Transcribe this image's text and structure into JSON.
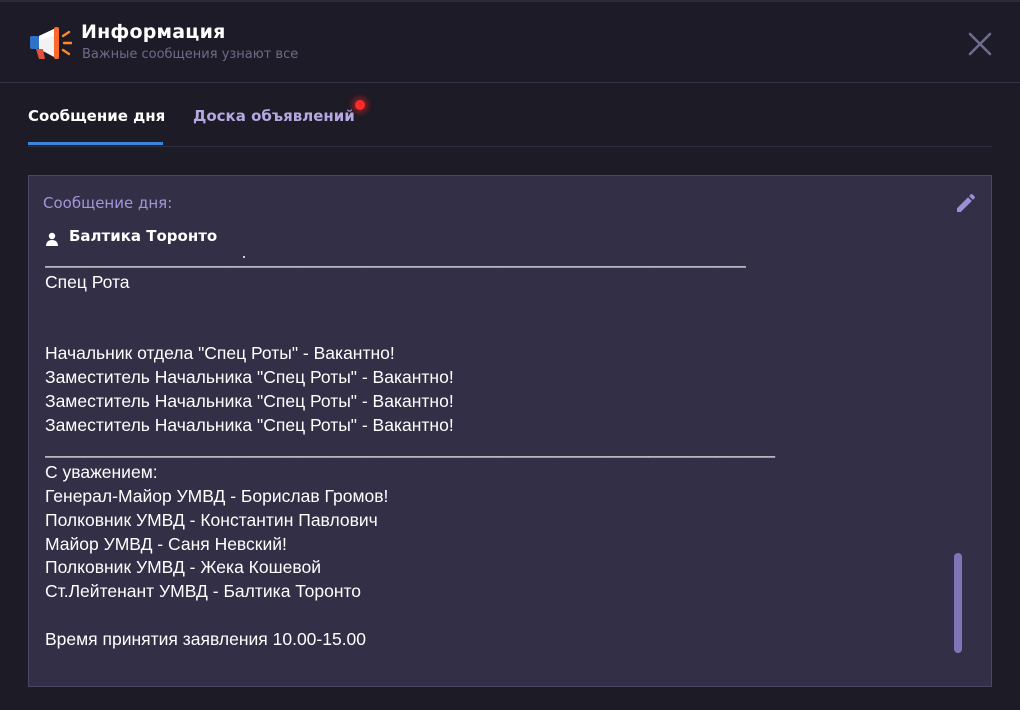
{
  "header": {
    "title": "Информация",
    "subtitle": "Важные сообщения узнают все",
    "icon": "megaphone-icon",
    "close_icon": "close-icon"
  },
  "tabs": [
    {
      "label": "Сообщение дня",
      "active": true
    },
    {
      "label": "Доска объявлений",
      "active": false,
      "has_notification": true
    }
  ],
  "panel": {
    "label": "Сообщение дня:",
    "author": "Балтика Торонто",
    "message": "________________________________________________________________________\nСпец Рота\n\n\nНачальник отдела \"Спец Роты\" - Вакантно!\nЗаместитель Начальника \"Спец Роты\" - Вакантно!\nЗаместитель Начальника \"Спец Роты\" - Вакантно!\nЗаместитель Начальника \"Спец Роты\" - Вакантно!\n___________________________________________________________________________\nС уважением:\nГенерал-Майор УМВД - Борислав Громов!\nПолковник УМВД - Константин Павлович\nМайор УМВД - Саня Невский!\nПолковник УМВД - Жека Кошевой\nСт.Лейтенант УМВД - Балтика Торонто\n\nВремя принятия заявления 10.00-15.00",
    "edit_icon": "pencil-icon"
  },
  "colors": {
    "background": "#1c1b26",
    "panel": "#322f46",
    "accent": "#3b86d9",
    "label": "#a596d8",
    "notification": "#ff2a2a",
    "scrollbar": "#7f76b8"
  }
}
